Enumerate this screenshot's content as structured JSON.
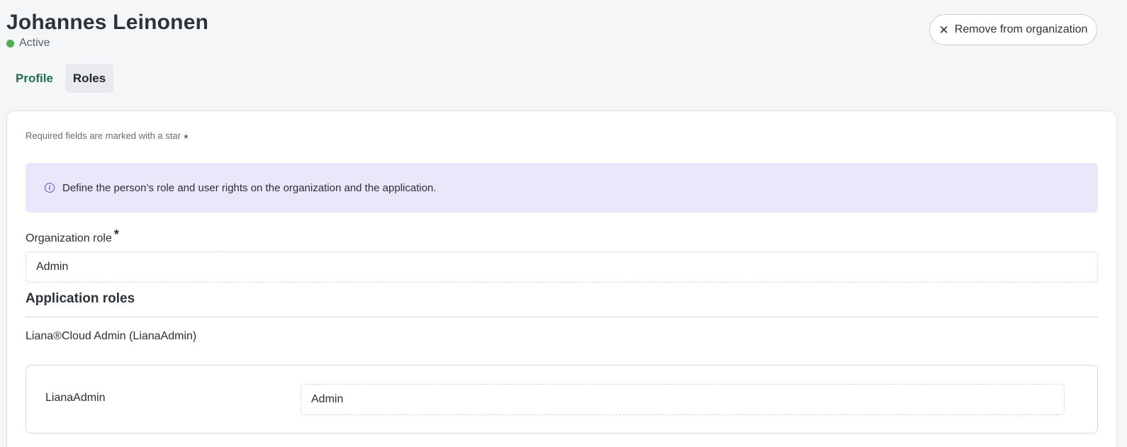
{
  "header": {
    "title": "Johannes Leinonen",
    "status": "Active",
    "status_color": "#4caf50"
  },
  "actions": {
    "remove_label": "Remove from organization",
    "remove_icon": "close-icon"
  },
  "tabs": [
    {
      "label": "Profile",
      "active": false
    },
    {
      "label": "Roles",
      "active": true
    }
  ],
  "form": {
    "required_note": "Required fields are marked with a star",
    "info_text": "Define the person’s role and user rights on the organization and the application.",
    "organization_role": {
      "label": "Organization role",
      "required_marker": "*",
      "value": "Admin"
    }
  },
  "application_roles": {
    "heading": "Application roles",
    "apps": [
      {
        "name": "Liana®Cloud Admin (LianaAdmin)",
        "roles": [
          {
            "label": "LianaAdmin",
            "value": "Admin"
          }
        ]
      }
    ]
  },
  "colors": {
    "accent_green": "#1f6b4f",
    "info_background": "#ebe7fa",
    "info_icon": "#6a4fc9"
  }
}
